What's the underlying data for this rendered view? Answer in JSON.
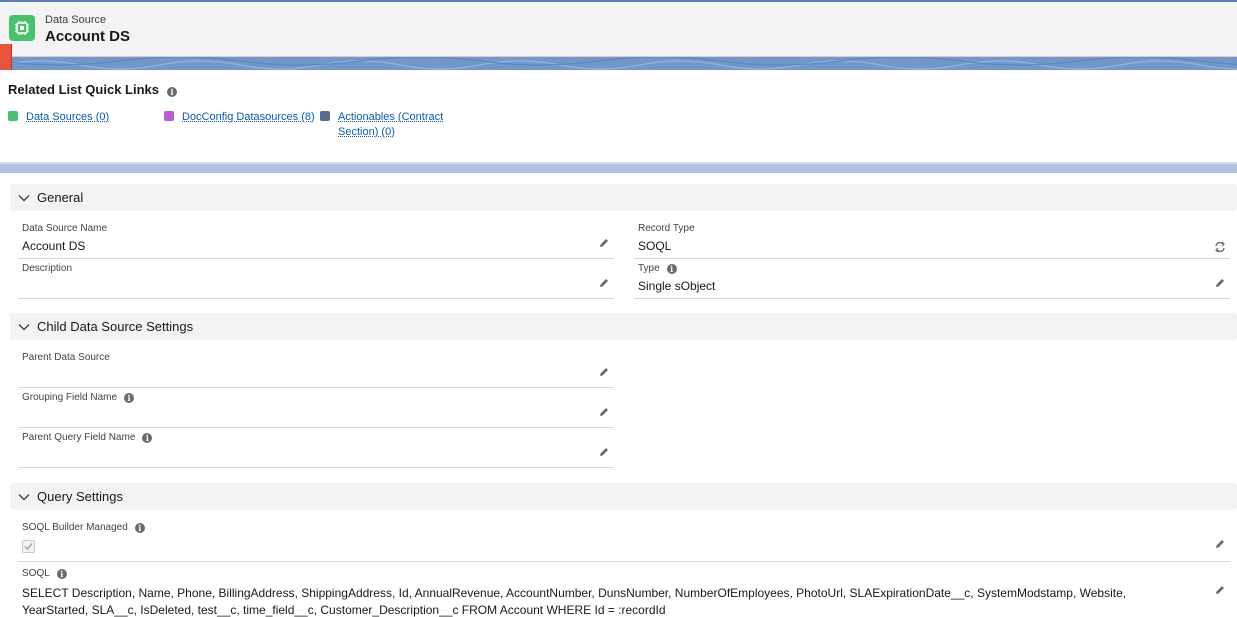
{
  "header": {
    "object_label": "Data Source",
    "record_name": "Account DS",
    "icon": "chip-icon",
    "icon_color": "#4bc16f"
  },
  "quick_links": {
    "title": "Related List Quick Links",
    "items": [
      {
        "label": "Data Sources (0)",
        "icon": "data-source-icon",
        "color": "#4bc16f"
      },
      {
        "label": "DocConfig Datasources (8)",
        "icon": "doc-config-icon",
        "color": "#b65fd4"
      },
      {
        "label": "Actionables (Contract",
        "label2": "Section) (0)",
        "icon": "wrench-icon",
        "color": "#5a6c8a"
      }
    ]
  },
  "sections": {
    "general": {
      "title": "General",
      "data_source_name_label": "Data Source Name",
      "data_source_name_value": "Account DS",
      "record_type_label": "Record Type",
      "record_type_value": "SOQL",
      "description_label": "Description",
      "description_value": "",
      "type_label": "Type",
      "type_value": "Single sObject"
    },
    "child": {
      "title": "Child Data Source Settings",
      "parent_label": "Parent Data Source",
      "parent_value": "",
      "grouping_label": "Grouping Field Name",
      "grouping_value": "",
      "parent_query_label": "Parent Query Field Name",
      "parent_query_value": ""
    },
    "query": {
      "title": "Query Settings",
      "builder_label": "SOQL Builder Managed",
      "builder_checked": true,
      "soql_label": "SOQL",
      "soql_value": "SELECT Description, Name, Phone, BillingAddress, ShippingAddress, Id, AnnualRevenue, AccountNumber, DunsNumber, NumberOfEmployees, PhotoUrl, SLAExpirationDate__c, SystemModstamp, Website, YearStarted, SLA__c, IsDeleted, test__c, time_field__c, Customer_Description__c FROM Account WHERE Id = :recordId"
    }
  }
}
